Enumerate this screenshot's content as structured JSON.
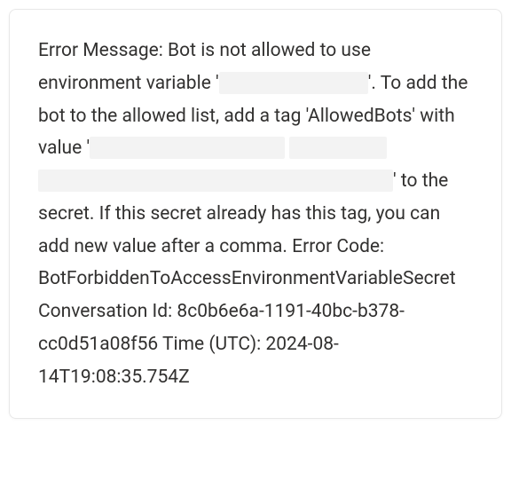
{
  "error": {
    "prefix": "Error Message: Bot is not allowed to use environment variable '",
    "mid1": "'. To add the bot to the allowed list, add a tag 'AllowedBots' with value '",
    "mid2": "' to the secret. If this secret already has this tag, you can add new value after a comma. Error Code: BotForbiddenToAccessEnvironmentVariableSecret Conversation Id: ",
    "conversation_id": "8c0b6e6a-1191-40bc-b378-cc0d51a08f56",
    "time_label": " Time (UTC): ",
    "time_value": "2024-08-14T19:08:35.754Z"
  }
}
